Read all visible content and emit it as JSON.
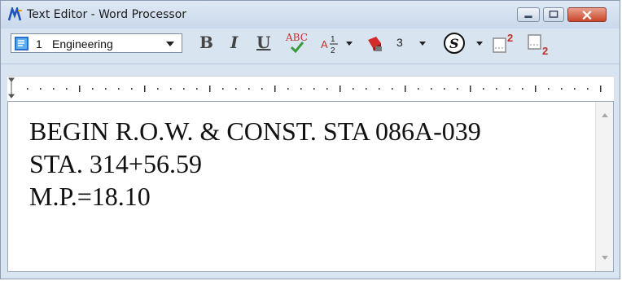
{
  "window": {
    "title": "Text Editor - Word Processor",
    "icons": {
      "app": "app-logo-icon",
      "minimize": "minimize-icon",
      "maximize": "maximize-icon",
      "close": "close-icon"
    }
  },
  "toolbar": {
    "style_select": {
      "number": "1",
      "name": "Engineering",
      "icon": "text-style-icon"
    },
    "bold_label": "B",
    "italic_label": "I",
    "underline_label": "U",
    "spellcheck_label": "ABC",
    "fraction_icon": "fraction-icon",
    "fill_icon": "fill-color-icon",
    "line_spacing_value": "3",
    "s_icon": "special-character-icon",
    "superscript_icon": "superscript-icon",
    "subscript_icon": "subscript-icon"
  },
  "editor": {
    "lines": [
      "BEGIN R.O.W. & CONST. STA 086A-039",
      "STA. 314+56.59",
      "M.P.=18.10"
    ]
  },
  "colors": {
    "window_bg": "#d9e4f1",
    "close_red": "#c9452a",
    "check_green": "#3a9a3a"
  }
}
